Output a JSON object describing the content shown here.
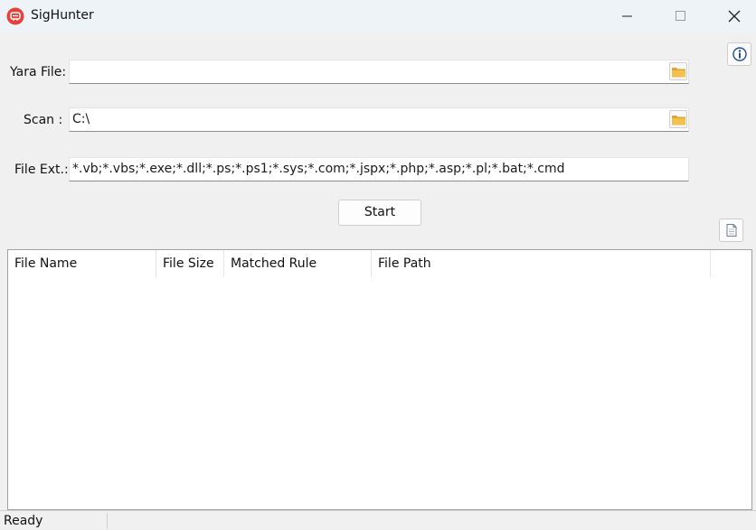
{
  "window": {
    "title": "SigHunter",
    "icon": "sighunter-app-icon",
    "controls": [
      "minimize-icon",
      "maximize-icon",
      "close-icon"
    ]
  },
  "form": {
    "yara_label": "Yara File:",
    "yara_value": "",
    "scan_label": "Scan :",
    "scan_value": "C:\\",
    "ext_label": "File Ext.:",
    "ext_value": "*.vb;*.vbs;*.exe;*.dll;*.ps;*.ps1;*.sys;*.com;*.jspx;*.php;*.asp;*.pl;*.bat;*.cmd",
    "browse_icon": "folder-icon"
  },
  "toolbar": {
    "start_label": "Start",
    "info_icon": "info-icon",
    "report_icon": "document-icon"
  },
  "results": {
    "columns": [
      "File Name",
      "File Size",
      "Matched Rule",
      "File Path"
    ],
    "rows": []
  },
  "status": {
    "text": "Ready"
  },
  "colors": {
    "titlebar": "#eef3f7",
    "window_bg": "#f0f0f0",
    "app_icon_red": "#e8413c",
    "folder_yellow": "#f2c14e",
    "info_blue": "#1f4e9c"
  }
}
